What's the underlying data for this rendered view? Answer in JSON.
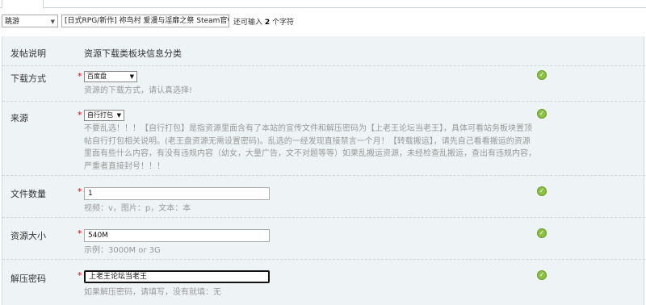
{
  "topbar": {
    "type_select": "跳游",
    "title_value": "[日式RPG/新作] 祢鸟村 爱漫与淫靡之祭 Steam官中版+E",
    "remain_prefix": "还可输入",
    "remain_count": "2",
    "remain_suffix": "个字符"
  },
  "header": {
    "label": "发帖说明",
    "section": "资源下载类板块信息分类"
  },
  "fields": [
    {
      "label": "下载方式",
      "required": "*",
      "value": "百度盘",
      "hint": "资源的下载方式，请认真选择!"
    },
    {
      "label": "来源",
      "required": "*",
      "value": "自行打包",
      "hint": "不要乱选！！！【自行打包】是指资源里面含有了本站的宣传文件和解压密码为【上老王论坛当老王】，具体可看站务板块置顶帖自行打包相关说明。(老王盘资源无需设置密码)。乱选的一经发现直接禁言一个月！【转载搬运】，请先自己看看搬运的资源里面有些什么内容，有没有违规内容（幼女，大量广告，文不对题等等）如果乱搬运资源，未经检查乱搬运，查出有违规内容，严重者直接封号！！！"
    },
    {
      "label": "文件数量",
      "required": "*",
      "value": "1",
      "hint": "视频：v，图片：p，文本：本"
    },
    {
      "label": "资源大小",
      "required": "*",
      "value": "540M",
      "hint": "示例：3000M or 3G"
    },
    {
      "label": "解压密码",
      "required": "*",
      "value": "上老王论坛当老王",
      "hint": "如果解压密码，请填写，没有就填：无"
    }
  ],
  "status_icon": "check-circle-icon",
  "colors": {
    "panel_bg": "#eef3f6",
    "ok_green": "#8cc23f",
    "required_red": "#ee0000"
  }
}
